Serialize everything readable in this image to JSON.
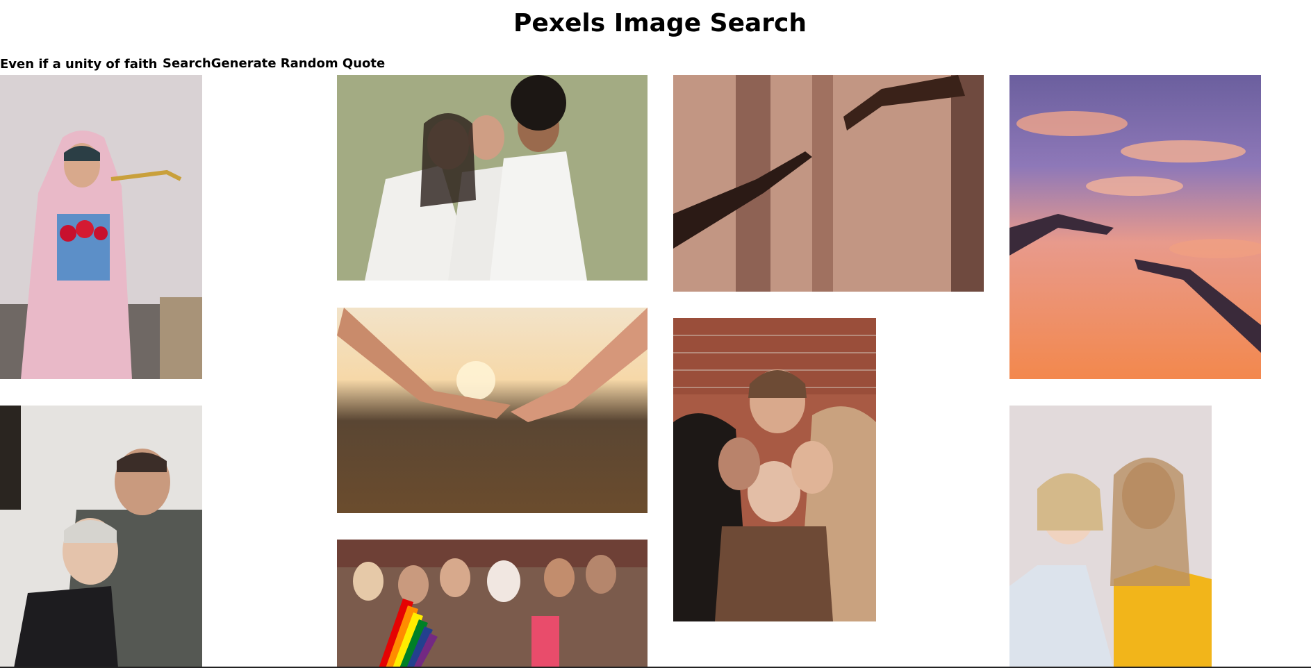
{
  "page": {
    "title": "Pexels Image Search"
  },
  "search": {
    "value": "Even if a unity of faith is n",
    "search_label": "Search",
    "random_quote_label": "Generate Random Quote"
  },
  "colors": {
    "background": "#ffffff",
    "text": "#000000"
  }
}
